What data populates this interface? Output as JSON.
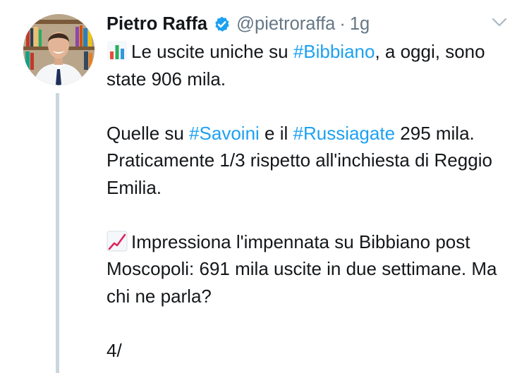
{
  "tweet": {
    "author": {
      "name": "Pietro Raffa",
      "handle": "@pietroraffa",
      "separator": "·",
      "time": "1g"
    },
    "paragraph1": {
      "text_1": "Le uscite uniche su ",
      "hashtag_1": "#Bibbiano",
      "text_2": ", a oggi, sono state 906 mila."
    },
    "paragraph2": {
      "text_1": "Quelle su ",
      "hashtag_1": "#Savoini",
      "text_2": " e il ",
      "hashtag_2": "#Russiagate",
      "text_3": " 295 mila. Praticamente 1/3 rispetto all'inchiesta di Reggio Emilia."
    },
    "paragraph3": {
      "text_1": "Impressiona l'impennata su Bibbiano post Moscopoli: 691 mila uscite in due settimane. Ma chi ne parla?"
    },
    "paragraph4": {
      "text_1": "4/"
    }
  },
  "icons": {
    "verified": "verified-badge-icon",
    "chevron": "chevron-down-icon",
    "emoji_1": "bar-chart-emoji-icon",
    "emoji_2": "chart-increasing-emoji-icon"
  },
  "colors": {
    "text": "#14171a",
    "muted": "#657786",
    "link": "#1da1f2",
    "thread_line": "#ccd6dd",
    "verified_badge": "#1da1f2"
  }
}
